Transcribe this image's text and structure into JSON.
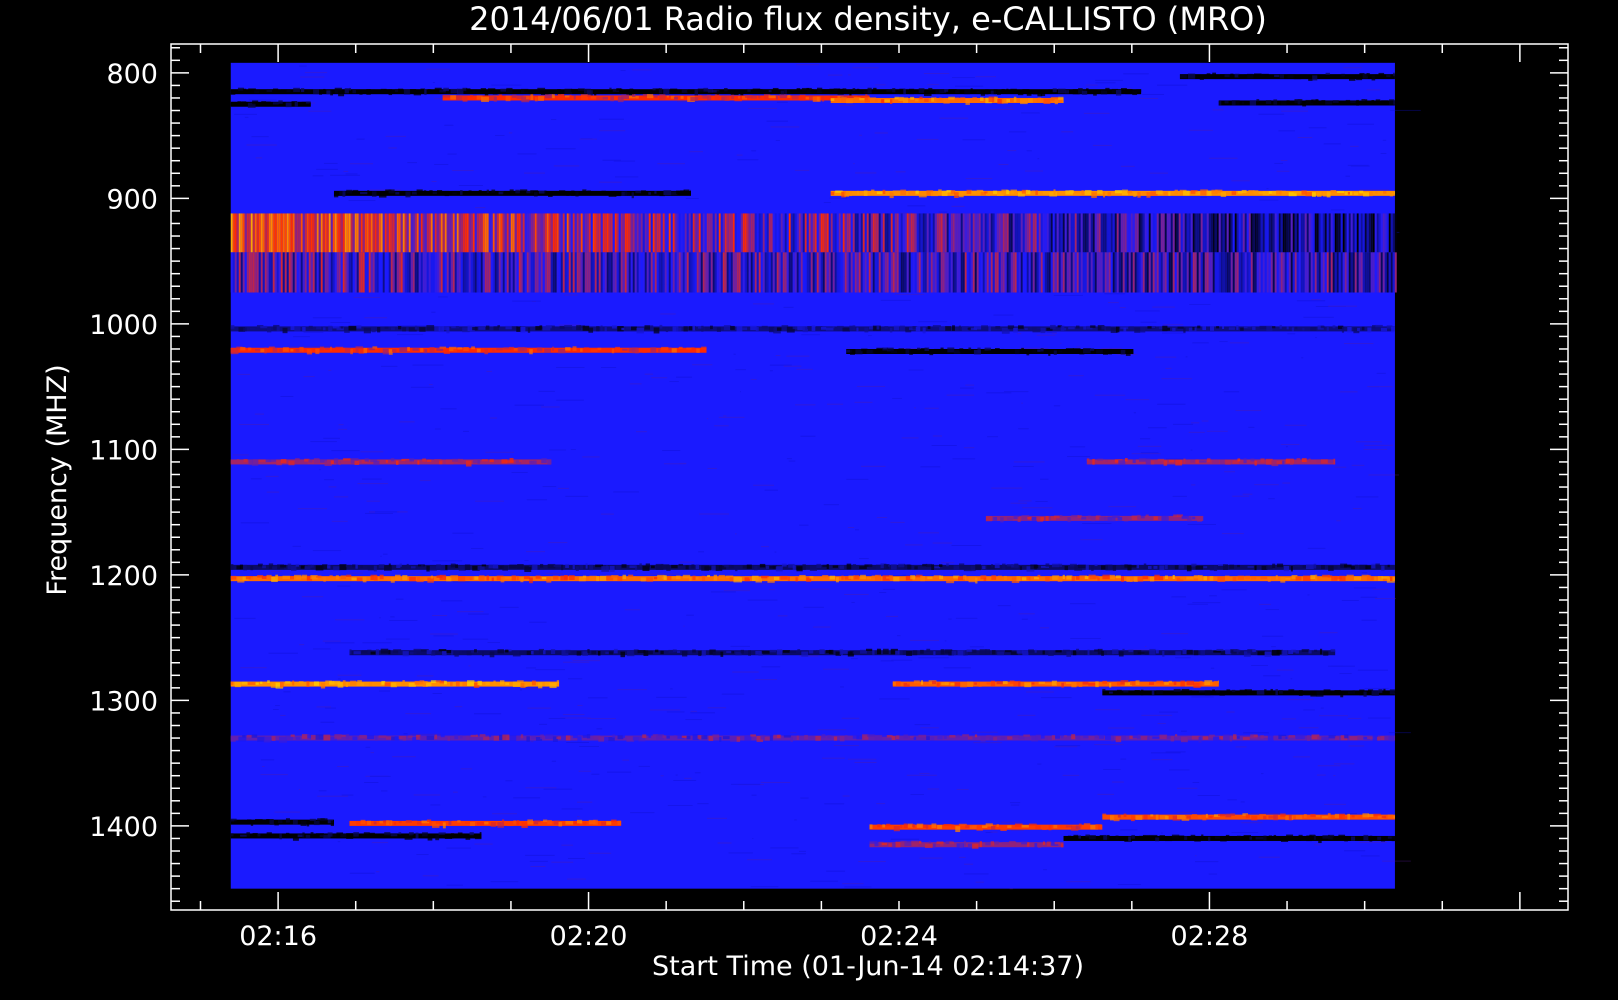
{
  "chart_data": {
    "type": "heatmap",
    "title": "2014/06/01  Radio flux density, e-CALLISTO (MRO)",
    "xlabel": "Start Time (01-Jun-14 02:14:37)",
    "ylabel": "Frequency (MHZ)",
    "x_range_minutes": [
      0,
      18
    ],
    "x_ticks": [
      {
        "label": "02:16",
        "minute": 1.38
      },
      {
        "label": "02:20",
        "minute": 5.38
      },
      {
        "label": "02:24",
        "minute": 9.38
      },
      {
        "label": "02:28",
        "minute": 13.38
      }
    ],
    "data_x_range_minutes": [
      0.77,
      15.77
    ],
    "y_range_mhz": [
      777,
      1467
    ],
    "data_y_range_mhz": [
      792,
      1450
    ],
    "y_ticks": [
      800,
      900,
      1000,
      1100,
      1200,
      1300,
      1400
    ],
    "y_inverted": true,
    "colormap": [
      "#000000",
      "#1a1aff",
      "#ff2a00",
      "#ffd000"
    ],
    "background_color": "#1a1aff",
    "bands": [
      {
        "mhz": 803,
        "t0": 13.0,
        "t1": 15.77,
        "level": 0
      },
      {
        "mhz": 815,
        "t0": 0.77,
        "t1": 12.5,
        "level": 0
      },
      {
        "mhz": 820,
        "t0": 3.5,
        "t1": 9.0,
        "level": 2
      },
      {
        "mhz": 822,
        "t0": 8.5,
        "t1": 11.5,
        "level": 2.4
      },
      {
        "mhz": 824,
        "t0": 13.5,
        "t1": 15.77,
        "level": 0
      },
      {
        "mhz": 825,
        "t0": 0.77,
        "t1": 1.8,
        "level": 0
      },
      {
        "mhz": 896,
        "t0": 2.1,
        "t1": 6.7,
        "level": 0
      },
      {
        "mhz": 896,
        "t0": 8.5,
        "t1": 15.77,
        "level": 2.6
      },
      {
        "mhz": 1004,
        "t0": 0.77,
        "t1": 15.77,
        "level": 0.5
      },
      {
        "mhz": 1021,
        "t0": 0.77,
        "t1": 6.9,
        "level": 2
      },
      {
        "mhz": 1022,
        "t0": 8.7,
        "t1": 12.4,
        "level": 0
      },
      {
        "mhz": 1110,
        "t0": 0.77,
        "t1": 4.9,
        "level": 1.6
      },
      {
        "mhz": 1110,
        "t0": 11.8,
        "t1": 15.0,
        "level": 1.6
      },
      {
        "mhz": 1155,
        "t0": 10.5,
        "t1": 13.3,
        "level": 1.5
      },
      {
        "mhz": 1194,
        "t0": 0.77,
        "t1": 15.77,
        "level": 0.4
      },
      {
        "mhz": 1203,
        "t0": 0.77,
        "t1": 15.77,
        "level": 2.4
      },
      {
        "mhz": 1262,
        "t0": 2.3,
        "t1": 15.0,
        "level": 0.4
      },
      {
        "mhz": 1287,
        "t0": 0.77,
        "t1": 5.0,
        "level": 2.6
      },
      {
        "mhz": 1287,
        "t0": 9.3,
        "t1": 13.5,
        "level": 2.3
      },
      {
        "mhz": 1294,
        "t0": 12.0,
        "t1": 15.77,
        "level": 0
      },
      {
        "mhz": 1330,
        "t0": 0.77,
        "t1": 15.77,
        "level": 1.3
      },
      {
        "mhz": 1397,
        "t0": 0.77,
        "t1": 2.1,
        "level": 0
      },
      {
        "mhz": 1398,
        "t0": 2.3,
        "t1": 5.8,
        "level": 2.1
      },
      {
        "mhz": 1401,
        "t0": 9.0,
        "t1": 12.0,
        "level": 2.1
      },
      {
        "mhz": 1393,
        "t0": 12.0,
        "t1": 15.77,
        "level": 2.2
      },
      {
        "mhz": 1408,
        "t0": 0.77,
        "t1": 4.0,
        "level": 0
      },
      {
        "mhz": 1410,
        "t0": 11.5,
        "t1": 15.77,
        "level": 0
      },
      {
        "mhz": 1415,
        "t0": 9.0,
        "t1": 11.5,
        "level": 1.5
      }
    ],
    "striped_regions": [
      {
        "mhz0": 912,
        "mhz1": 943,
        "t0": 0.77,
        "t1": 15.77,
        "level_start": 2.1,
        "level_end": 0.5
      },
      {
        "mhz0": 943,
        "mhz1": 975,
        "t0": 0.77,
        "t1": 15.77,
        "level_start": 1.2,
        "level_end": 0.9
      }
    ]
  }
}
